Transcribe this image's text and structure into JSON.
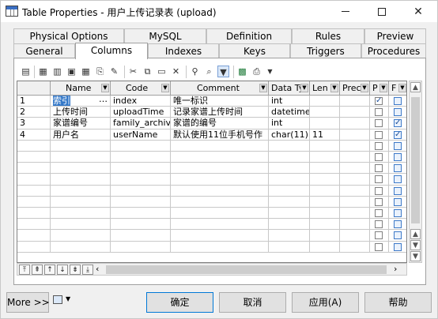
{
  "window": {
    "title": "Table Properties - 用户上传记录表 (upload)"
  },
  "tabs_row1": [
    {
      "label": "Physical Options"
    },
    {
      "label": "MySQL"
    },
    {
      "label": "Definition"
    },
    {
      "label": "Rules"
    },
    {
      "label": "Preview"
    }
  ],
  "tabs_row2": [
    {
      "label": "General"
    },
    {
      "label": "Columns"
    },
    {
      "label": "Indexes"
    },
    {
      "label": "Keys"
    },
    {
      "label": "Triggers"
    },
    {
      "label": "Procedures"
    }
  ],
  "active_tab": "Columns",
  "toolbar": {
    "icons": [
      "properties-icon",
      "add-row-icon",
      "insert-row-icon",
      "add-columns-icon",
      "add-list-icon",
      "replicate-icon",
      "cut-icon",
      "copy-icon",
      "paste-icon",
      "delete-icon",
      "find-icon",
      "filter-icon",
      "customize-columns-icon",
      "excel-export-icon",
      "print-icon",
      "dropdown-arrow-icon"
    ]
  },
  "grid": {
    "headers": [
      "Name",
      "Code",
      "Comment",
      "Data Ty",
      "Len",
      "Prec",
      "P",
      "F"
    ],
    "rows": [
      {
        "num": "1",
        "name": "索引",
        "code": "index",
        "comment": "唯一标识",
        "datatype": "int",
        "length": "",
        "precision": "",
        "primary": true,
        "foreign": false
      },
      {
        "num": "2",
        "name": "上传时间",
        "code": "uploadTime",
        "comment": "记录家谱上传时间",
        "datatype": "datetime",
        "length": "",
        "precision": "",
        "primary": false,
        "foreign": false
      },
      {
        "num": "3",
        "name": "家谱编号",
        "code": "family_archive_",
        "comment": "家谱的编号",
        "datatype": "int",
        "length": "",
        "precision": "",
        "primary": false,
        "foreign": true
      },
      {
        "num": "4",
        "name": "用户名",
        "code": "userName",
        "comment": "默认使用11位手机号作",
        "datatype": "char(11)",
        "length": "11",
        "precision": "",
        "primary": false,
        "foreign": true
      }
    ],
    "empty_row_count": 10
  },
  "buttons": {
    "more": "More >>",
    "ok": "确定",
    "cancel": "取消",
    "apply": "应用(A)",
    "help": "帮助"
  }
}
